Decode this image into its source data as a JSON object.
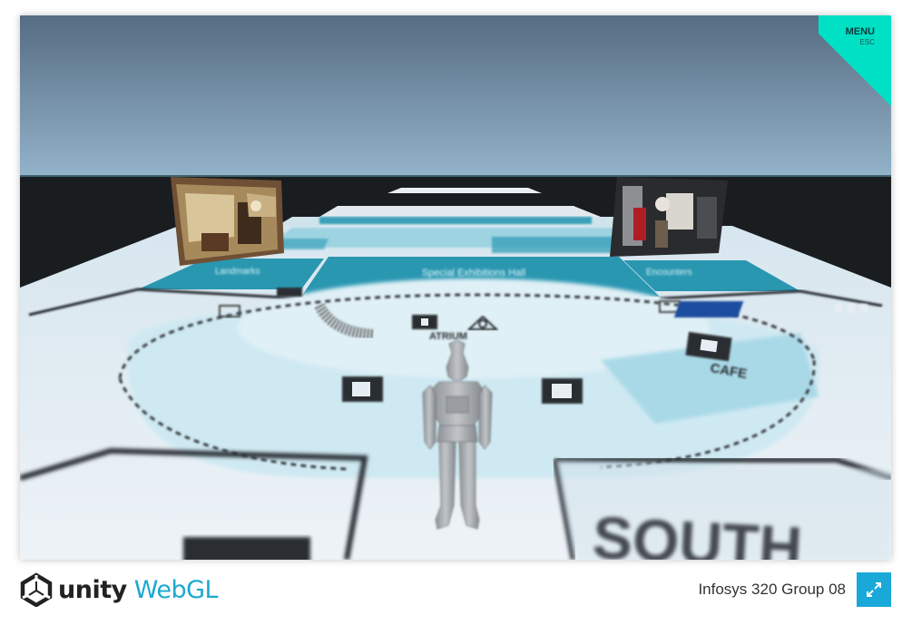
{
  "game": {
    "menu_label": "MENU",
    "menu_shortcut": "ESC",
    "signs": {
      "special_exhibitions": "Special Exhibitions Hall",
      "left_gallery": "Landmarks",
      "right_gallery": "Encounters",
      "atrium": "ATRIUM",
      "cafe": "CAFE",
      "south": "SOUTH"
    },
    "accent_color": "#00e0c4",
    "floor_teal": "#2a9bb5"
  },
  "footer": {
    "engine_name": "unity",
    "platform": "WebGL",
    "build_title": "Infosys 320 Group 08",
    "fullscreen_icon": "fullscreen-icon"
  }
}
